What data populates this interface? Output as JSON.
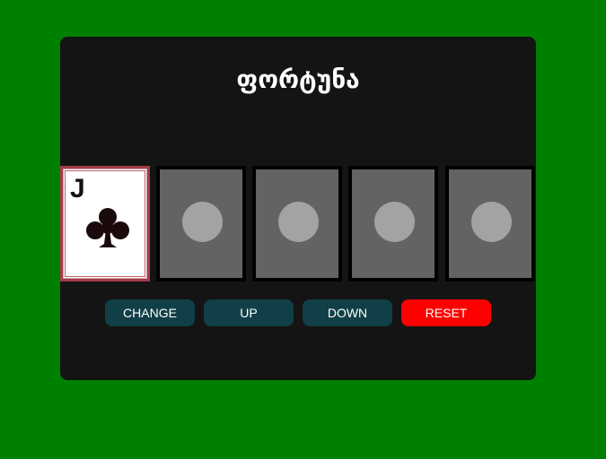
{
  "page": {
    "background_color": "#008000",
    "panel_color": "#141414"
  },
  "game": {
    "title": "ფორტუნა"
  },
  "cards": [
    {
      "state": "face-up",
      "rank": "J",
      "suit": "clubs",
      "suit_icon": "club-icon"
    },
    {
      "state": "face-down",
      "back_icon": "circle-icon"
    },
    {
      "state": "face-down",
      "back_icon": "circle-icon"
    },
    {
      "state": "face-down",
      "back_icon": "circle-icon"
    },
    {
      "state": "face-down",
      "back_icon": "circle-icon"
    }
  ],
  "controls": {
    "change_label": "CHANGE",
    "up_label": "UP",
    "down_label": "DOWN",
    "reset_label": "RESET",
    "button_color": "#113f47",
    "reset_color": "#ff0000"
  }
}
